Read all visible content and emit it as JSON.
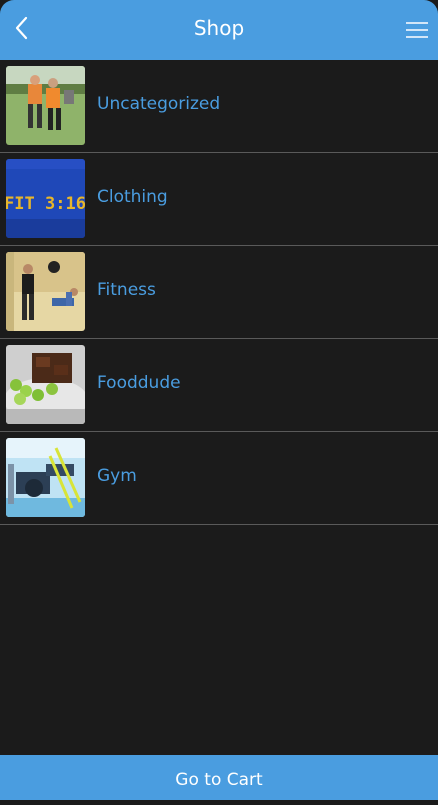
{
  "header": {
    "title": "Shop",
    "back_icon": "chevron-left-icon",
    "menu_icon": "hamburger-menu-icon"
  },
  "categories": [
    {
      "label": "Uncategorized"
    },
    {
      "label": "Clothing",
      "thumb_text": "FIT 3:16"
    },
    {
      "label": "Fitness"
    },
    {
      "label": "Fooddude"
    },
    {
      "label": "Gym"
    }
  ],
  "footer": {
    "button_label": "Go to Cart"
  },
  "colors": {
    "accent": "#4a9de0",
    "background": "#1b1b1b",
    "divider": "#5a5a5a"
  }
}
